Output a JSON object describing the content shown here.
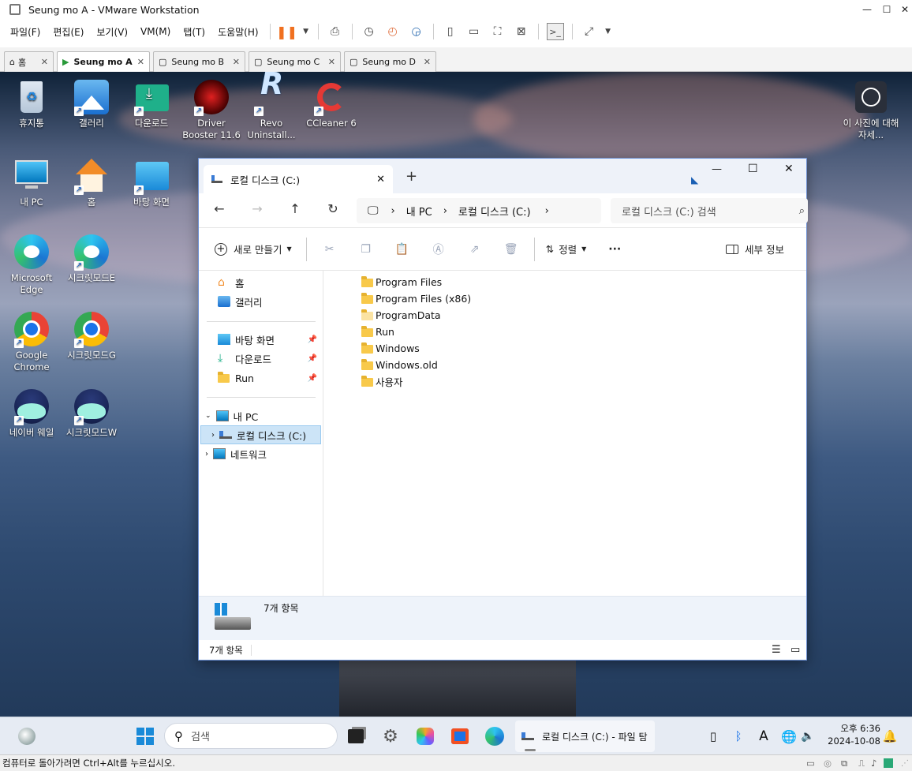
{
  "vm": {
    "title": "Seung mo A - VMware Workstation",
    "menu": [
      "파일(F)",
      "편집(E)",
      "보기(V)",
      "VM(M)",
      "탭(T)",
      "도움말(H)"
    ],
    "tabs": [
      "홈",
      "Seung mo A",
      "Seung mo B",
      "Seung mo C",
      "Seung mo D"
    ],
    "status_hint": "컴퓨터로 돌아가려면 Ctrl+Alt를 누르십시오."
  },
  "desktop": {
    "icons_top": [
      "휴지통",
      "갤러리",
      "다운로드",
      "Driver Booster 11.6",
      "Revo Uninstall...",
      "CCleaner 6"
    ],
    "icons_left": [
      "내 PC",
      "홈",
      "바탕 화면",
      "Microsoft Edge",
      "시크릿모드E",
      "Google Chrome",
      "시크릿모드G",
      "네이버 웨일",
      "시크릿모드W"
    ],
    "spotlight": "이 사진에 대해 자세..."
  },
  "explorer": {
    "tab_title": "로컬 디스크 (C:)",
    "breadcrumb": [
      "내 PC",
      "로컬 디스크 (C:)"
    ],
    "search_placeholder": "로컬 디스크 (C:) 검색",
    "cmd": {
      "new": "새로 만들기",
      "sort": "정렬",
      "more": "···",
      "details": "세부 정보"
    },
    "nav": {
      "home": "홈",
      "gallery": "갤러리",
      "desktop": "바탕 화면",
      "downloads": "다운로드",
      "run": "Run",
      "this_pc": "내 PC",
      "local_disk": "로컬 디스크 (C:)",
      "network": "네트워크"
    },
    "files": [
      "Program Files",
      "Program Files (x86)",
      "ProgramData",
      "Run",
      "Windows",
      "Windows.old",
      "사용자"
    ],
    "details_count": "7개 항목",
    "status_count": "7개 항목"
  },
  "taskbar": {
    "search": "검색",
    "active_window": "로컬 디스크 (C:) - 파일 탐",
    "time": "오후 6:36",
    "date": "2024-10-08",
    "ime": "A"
  }
}
